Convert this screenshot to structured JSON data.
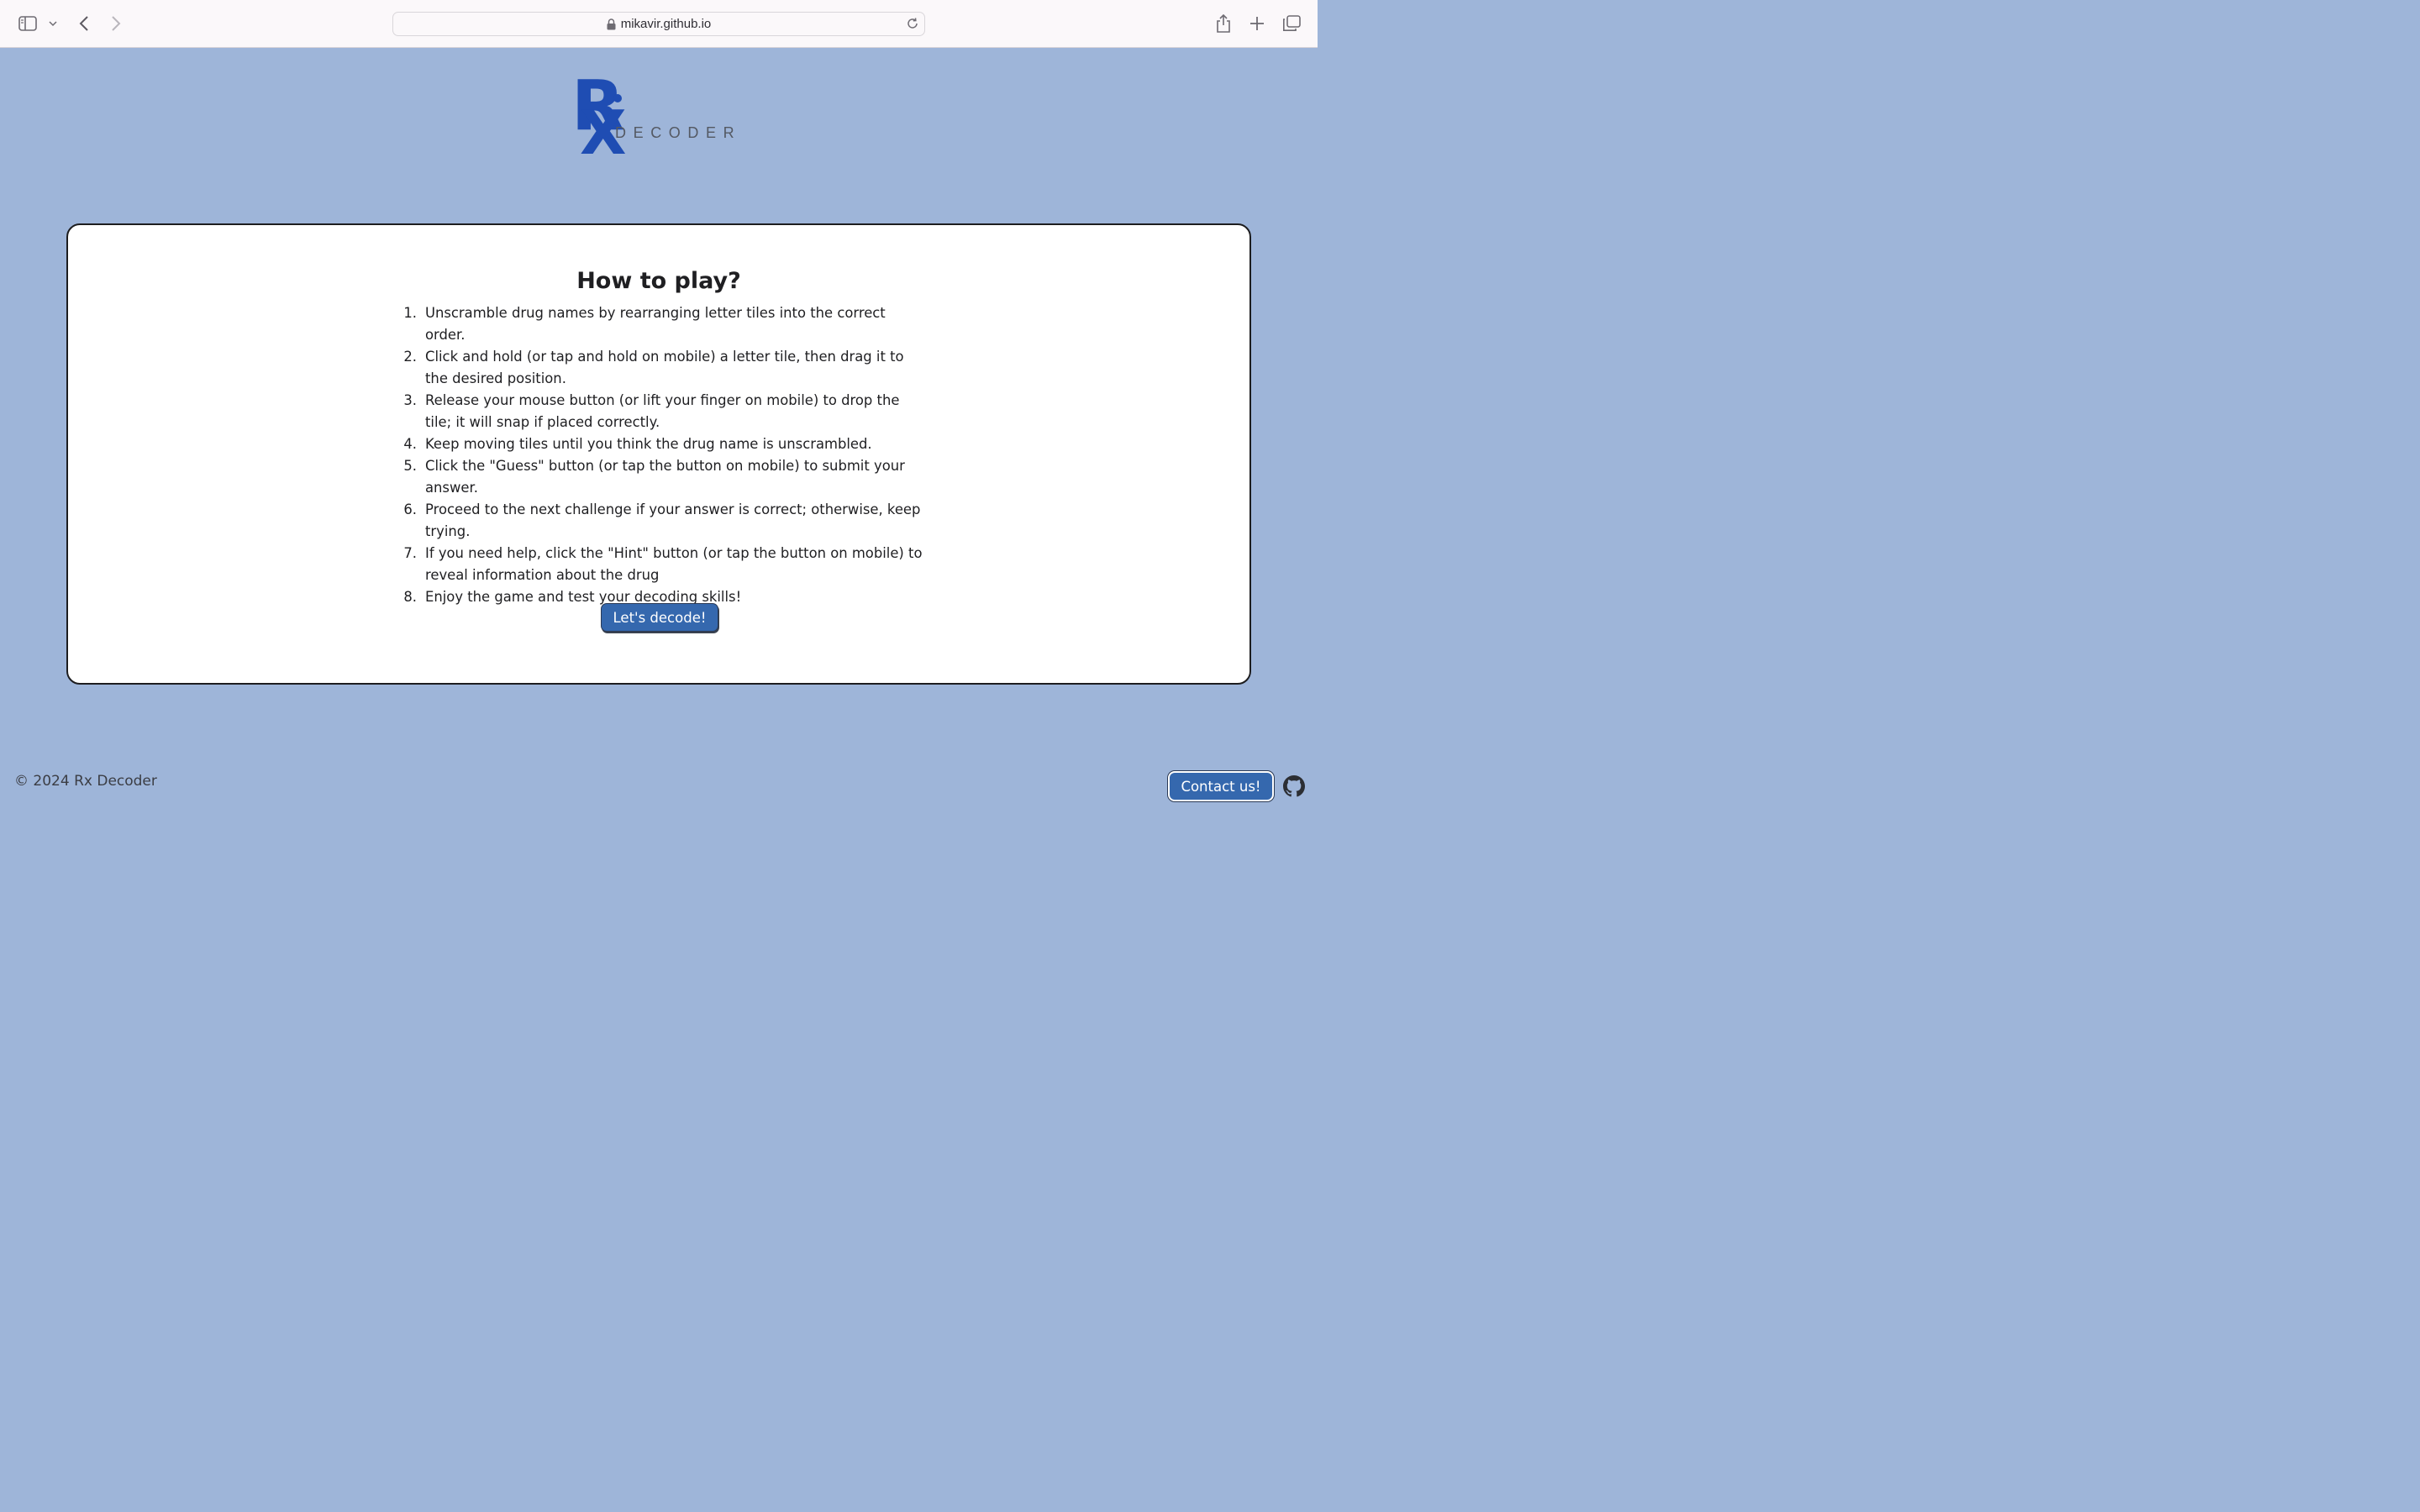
{
  "browser": {
    "url": "mikavir.github.io"
  },
  "logo": {
    "mark_r": "R",
    "mark_x": "X",
    "word": "DECODER",
    "color": "#1f4db3"
  },
  "main": {
    "title": "How to play?",
    "steps": [
      {
        "num": "1.",
        "text": "Unscramble drug names by rearranging letter tiles into the correct order."
      },
      {
        "num": "2.",
        "text": "Click and hold (or tap and hold on mobile) a letter tile, then drag it to the desired position."
      },
      {
        "num": "3.",
        "text": "Release your mouse button (or lift your finger on mobile) to drop the tile; it will snap if placed correctly."
      },
      {
        "num": "4.",
        "text": "Keep moving tiles until you think the drug name is unscrambled."
      },
      {
        "num": "5.",
        "text": "Click the \"Guess\" button (or tap the button on mobile) to submit your answer."
      },
      {
        "num": "6.",
        "text": "Proceed to the next challenge if your answer is correct; otherwise, keep trying."
      },
      {
        "num": "7.",
        "text": "If you need help, click the \"Hint\" button (or tap the button on mobile) to reveal information about the drug"
      },
      {
        "num": "8.",
        "text": "Enjoy the game and test your decoding skills!"
      }
    ],
    "cta_label": "Let's decode!"
  },
  "footer": {
    "copyright": "© 2024 Rx Decoder",
    "contact_label": "Contact us!"
  },
  "colors": {
    "background": "#9eb5d9",
    "button": "#3568ae"
  }
}
